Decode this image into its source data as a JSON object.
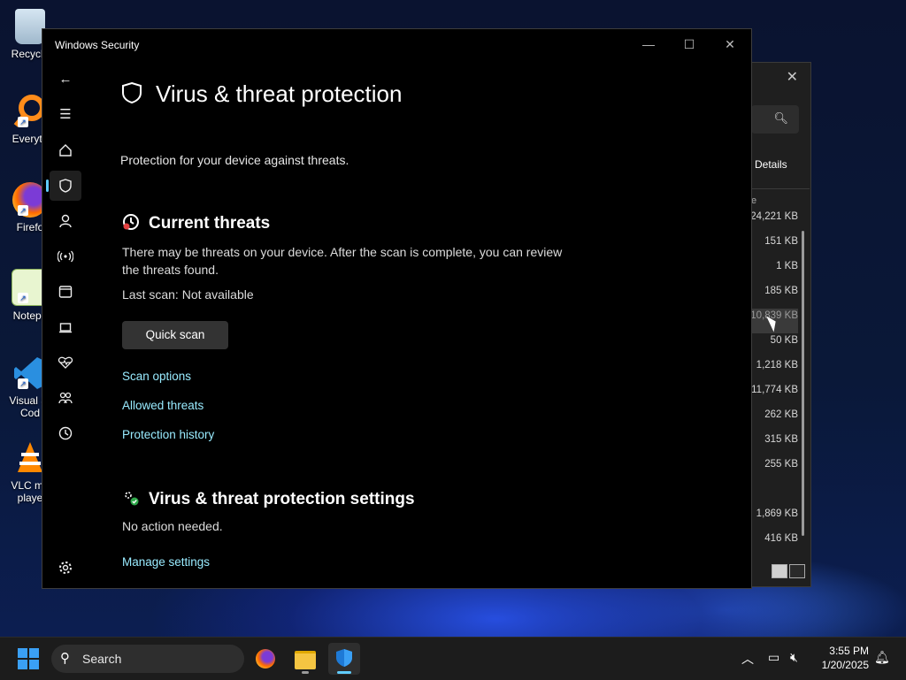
{
  "desktop": {
    "icons": [
      {
        "label": "Recycle",
        "icon": "recycle-bin-icon"
      },
      {
        "label": "Everyth",
        "icon": "everything-search-icon"
      },
      {
        "label": "Firefo",
        "icon": "firefox-icon"
      },
      {
        "label": "Notepa",
        "icon": "notepad-icon"
      },
      {
        "label": "Visual St\nCod",
        "icon": "vscode-icon"
      },
      {
        "label": "VLC me\nplaye",
        "icon": "vlc-icon"
      }
    ]
  },
  "explorer": {
    "details_label": "Details",
    "column_header": "e",
    "sizes": [
      "24,221 KB",
      "151 KB",
      "1 KB",
      "185 KB",
      "10,839 KB",
      "50 KB",
      "1,218 KB",
      "11,774 KB",
      "262 KB",
      "315 KB",
      "255 KB",
      "",
      "1,869 KB",
      "416 KB"
    ],
    "selected_index": 4
  },
  "window": {
    "title": "Windows Security",
    "page_title": "Virus & threat protection",
    "subtitle": "Protection for your device against threats.",
    "current_threats": {
      "heading": "Current threats",
      "description": "There may be threats on your device. After the scan is complete, you can review the threats found.",
      "last_scan": "Last scan: Not available",
      "quick_scan_label": "Quick scan",
      "links": [
        "Scan options",
        "Allowed threats",
        "Protection history"
      ]
    },
    "settings": {
      "heading": "Virus & threat protection settings",
      "status": "No action needed.",
      "manage_link": "Manage settings"
    },
    "nav": [
      "back-icon",
      "menu-icon",
      "home-icon",
      "shield-icon",
      "account-icon",
      "wifi-icon",
      "app-browser-icon",
      "laptop-icon",
      "health-icon",
      "family-icon",
      "history-icon",
      "settings-icon"
    ],
    "accent": "#60cdff",
    "link_color": "#99ebff"
  },
  "taskbar": {
    "search_label": "Search",
    "time": "3:55 PM",
    "date": "1/20/2025"
  }
}
